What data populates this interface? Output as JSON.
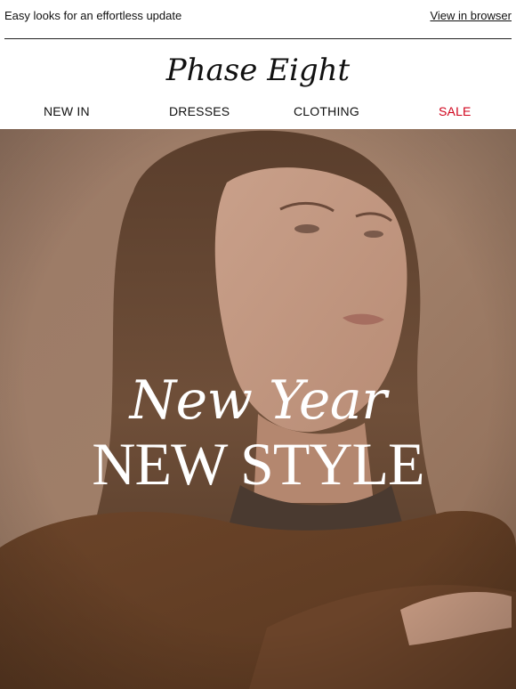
{
  "preheader": {
    "text": "Easy looks for an effortless update",
    "view_in_browser": "View in browser"
  },
  "brand": {
    "logo_text": "Phase Eight"
  },
  "nav": {
    "items": [
      {
        "label": "NEW IN"
      },
      {
        "label": "DRESSES"
      },
      {
        "label": "CLOTHING"
      },
      {
        "label": "SALE"
      }
    ],
    "sale_color": "#d0021b"
  },
  "hero": {
    "line1": "New Year",
    "line2": "NEW STYLE",
    "text_color": "#ffffff",
    "background_tone": "#8a6c58"
  }
}
